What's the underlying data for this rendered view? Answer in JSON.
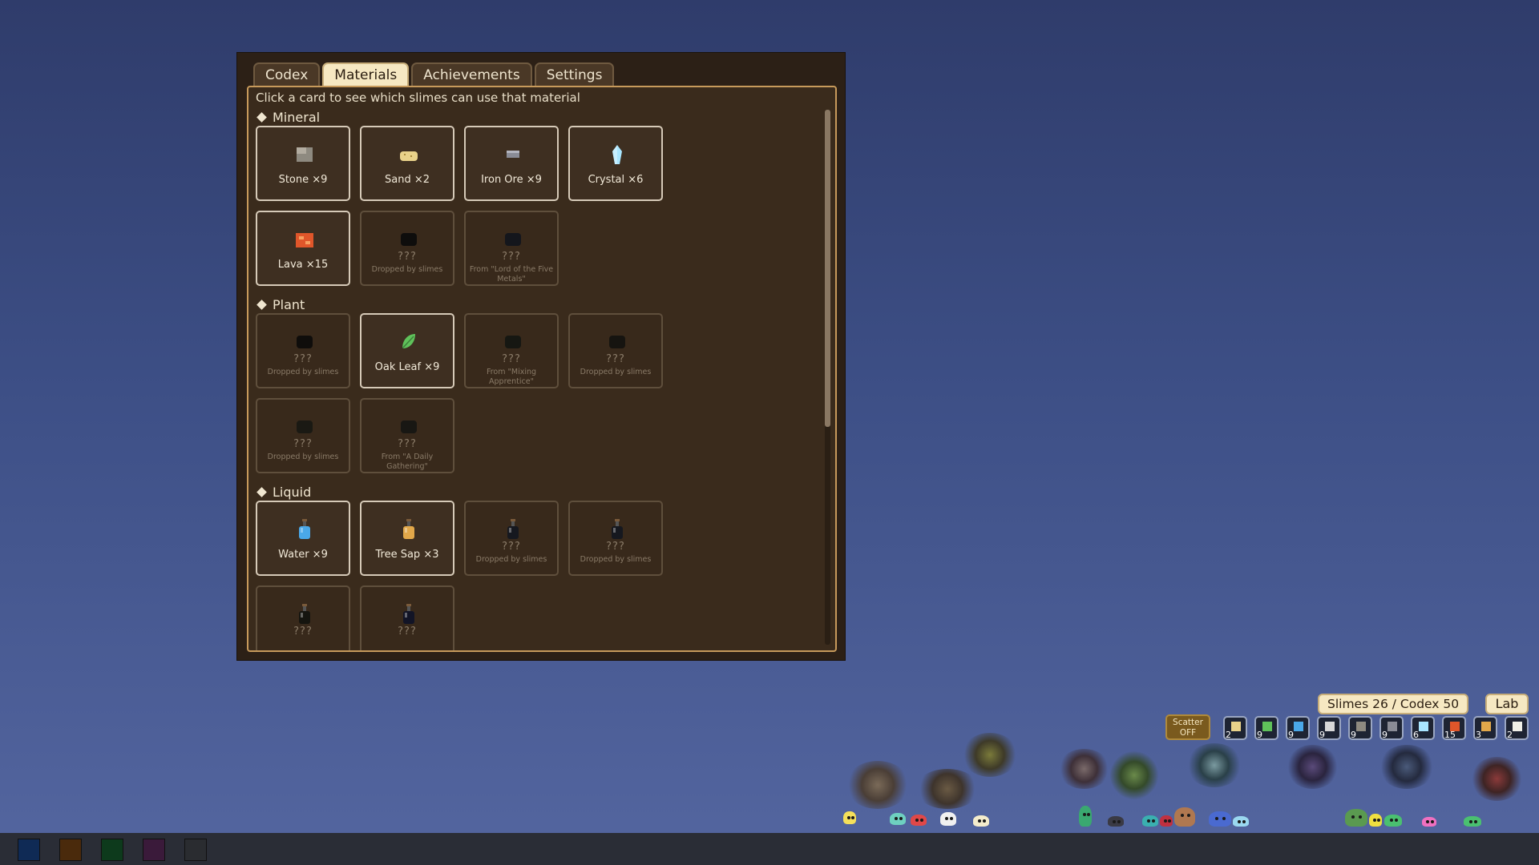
{
  "tabs": [
    "Codex",
    "Materials",
    "Achievements",
    "Settings"
  ],
  "active_tab": "Materials",
  "hint": "Click a card to see which slimes can use that material",
  "sections": [
    {
      "title": "Mineral",
      "rows": [
        [
          {
            "name": "Stone ×9",
            "icon": "stone-icon",
            "color": "#8e8a80",
            "known": true
          },
          {
            "name": "Sand ×2",
            "icon": "sand-icon",
            "color": "#e9d28a",
            "known": true
          },
          {
            "name": "Iron Ore ×9",
            "icon": "iron-ore-icon",
            "color": "#8a8c96",
            "known": true
          },
          {
            "name": "Crystal ×6",
            "icon": "crystal-icon",
            "color": "#a9e6ff",
            "known": true
          }
        ],
        [
          {
            "name": "Lava ×15",
            "icon": "lava-icon",
            "color": "#e0562a",
            "known": true
          },
          {
            "name": "???",
            "src": "Dropped by slimes",
            "icon": "unknown-mineral-icon",
            "color": "#0e0d0c",
            "known": false
          },
          {
            "name": "???",
            "src": "From \"Lord of the Five Metals\"",
            "icon": "unknown-mineral-icon",
            "color": "#14161c",
            "known": false
          }
        ]
      ]
    },
    {
      "title": "Plant",
      "rows": [
        [
          {
            "name": "???",
            "src": "Dropped by slimes",
            "icon": "unknown-plant-icon",
            "color": "#0f0d0b",
            "known": false
          },
          {
            "name": "Oak Leaf ×9",
            "icon": "oak-leaf-icon",
            "color": "#5fc25a",
            "known": true
          },
          {
            "name": "???",
            "src": "From \"Mixing Apprentice\"",
            "icon": "unknown-plant-icon",
            "color": "#161712",
            "known": false
          },
          {
            "name": "???",
            "src": "Dropped by slimes",
            "icon": "unknown-plant-icon",
            "color": "#161410",
            "known": false
          }
        ],
        [
          {
            "name": "???",
            "src": "Dropped by slimes",
            "icon": "unknown-plant-icon",
            "color": "#1a1913",
            "known": false
          },
          {
            "name": "???",
            "src": "From \"A Daily Gathering\"",
            "icon": "unknown-plant-icon",
            "color": "#181713",
            "known": false
          }
        ]
      ]
    },
    {
      "title": "Liquid",
      "rows": [
        [
          {
            "name": "Water ×9",
            "icon": "water-bottle-icon",
            "color": "#4aa8e8",
            "known": true
          },
          {
            "name": "Tree Sap ×3",
            "icon": "tree-sap-bottle-icon",
            "color": "#e2a84a",
            "known": true
          },
          {
            "name": "???",
            "src": "Dropped by slimes",
            "icon": "unknown-bottle-icon",
            "color": "#16181f",
            "known": false
          },
          {
            "name": "???",
            "src": "Dropped by slimes",
            "icon": "unknown-bottle-icon",
            "color": "#16181f",
            "known": false
          }
        ],
        [
          {
            "name": "???",
            "src": "",
            "icon": "unknown-bottle-icon",
            "color": "#15150f",
            "known": false
          },
          {
            "name": "???",
            "src": "",
            "icon": "unknown-bottle-icon",
            "color": "#121426",
            "known": false
          }
        ]
      ]
    }
  ],
  "hud": {
    "counter": "Slimes 26 / Codex 50",
    "lab": "Lab",
    "scatter_line1": "Scatter",
    "scatter_line2": "OFF",
    "slots": [
      {
        "num": "2",
        "icon": "sand-icon",
        "color": "#e9d28a"
      },
      {
        "num": "9",
        "icon": "oak-leaf-icon",
        "color": "#5fc25a"
      },
      {
        "num": "9",
        "icon": "water-bottle-icon",
        "color": "#4aa8e8"
      },
      {
        "num": "9",
        "icon": "feather-icon",
        "color": "#d8d8d8"
      },
      {
        "num": "9",
        "icon": "stone-icon",
        "color": "#8e8a80"
      },
      {
        "num": "9",
        "icon": "iron-ore-icon",
        "color": "#8a8c96"
      },
      {
        "num": "6",
        "icon": "crystal-icon",
        "color": "#a9e6ff"
      },
      {
        "num": "15",
        "icon": "lava-icon",
        "color": "#e0562a"
      },
      {
        "num": "3",
        "icon": "tree-sap-bottle-icon",
        "color": "#e2a84a"
      },
      {
        "num": "2",
        "icon": "bone-icon",
        "color": "#f0f0e8"
      }
    ]
  },
  "taskbar": [
    {
      "name": "taskbar-button-blue",
      "color": "#0f2a55"
    },
    {
      "name": "taskbar-button-brown",
      "color": "#4a2a0c"
    },
    {
      "name": "taskbar-button-green",
      "color": "#0d3a1c"
    },
    {
      "name": "taskbar-button-purple",
      "color": "#3a1a3a"
    },
    {
      "name": "taskbar-button-gray",
      "color": "#2a2c30"
    }
  ]
}
